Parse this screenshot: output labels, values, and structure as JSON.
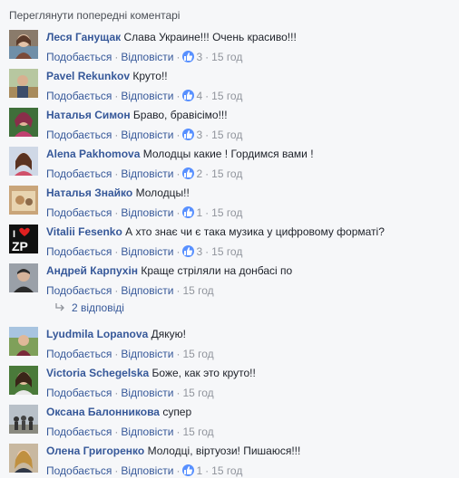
{
  "prev_comments_link": "Переглянути попередні коментарі",
  "labels": {
    "like": "Подобається",
    "reply": "Відповісти"
  },
  "comments": [
    {
      "author": "Леся Ганущак",
      "text": "Слава Украине!!! Очень красиво!!!",
      "likes": "3",
      "time": "15 год"
    },
    {
      "author": "Pavel Rekunkov",
      "text": "Круто!!",
      "likes": "4",
      "time": "15 год"
    },
    {
      "author": "Наталья Симон",
      "text": "Браво, бравісімо!!!",
      "likes": "3",
      "time": "15 год"
    },
    {
      "author": "Alena Pakhomova",
      "text": "Молодцы какие ! Гордимся вами !",
      "likes": "2",
      "time": "15 год"
    },
    {
      "author": "Наталья Знайко",
      "text": "Молодцы!!",
      "likes": "1",
      "time": "15 год"
    },
    {
      "author": "Vitalii Fesenko",
      "text": "А хто знає чи є така музика у цифровому форматі?",
      "likes": "3",
      "time": "15 год"
    },
    {
      "author": "Андрей Карпухін",
      "text": "Краще стріляли на донбасі по",
      "likes": "",
      "time": "15 год"
    },
    {
      "author": "Lyudmila Lopanova",
      "text": "Дякую!",
      "likes": "",
      "time": "15 год"
    },
    {
      "author": "Victoria Schegelska",
      "text": "Боже, как это круто!!",
      "likes": "",
      "time": "15 год"
    },
    {
      "author": "Оксана Балонникова",
      "text": "супер",
      "likes": "",
      "time": "15 год"
    },
    {
      "author": "Олена Григоренко",
      "text": "Молодці, віртуози! Пишаюся!!!",
      "likes": "1",
      "time": "15 год"
    }
  ],
  "replies_link": "2 відповіді",
  "avatar_logo_text": "I ♥ ZP",
  "colors": {
    "link": "#365899",
    "meta": "#90949c",
    "like": "#5890ff",
    "bg": "#f6f7f9"
  }
}
